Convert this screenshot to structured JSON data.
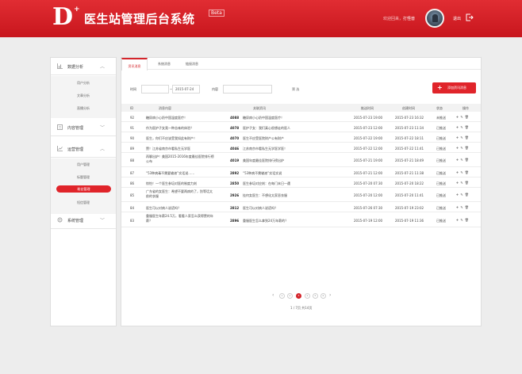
{
  "header": {
    "logo_letter": "D",
    "logo_plus": "+",
    "title": "医生站管理后台系统",
    "badge": "Beta",
    "welcome_prefix": "欢迎回来，",
    "username": "打怪兽",
    "logout": "退出"
  },
  "sidebar": {
    "groups": [
      {
        "label": "数据分析",
        "icon": "chart-icon",
        "items": [
          "用户分析",
          "文章分析",
          "直播分析"
        ]
      },
      {
        "label": "内容管理",
        "icon": "content-icon",
        "items": []
      },
      {
        "label": "运营管理",
        "icon": "operation-icon",
        "items": [
          "用户管理",
          "标题管理",
          "粉丝管理",
          "短信管理"
        ]
      },
      {
        "label": "系统管理",
        "icon": "gear-icon",
        "items": []
      }
    ],
    "active_item": "粉丝管理"
  },
  "tabs": [
    "资讯消息",
    "系统消息",
    "链接消息"
  ],
  "filter": {
    "time_label": "时间",
    "date_from": "",
    "separator": "—",
    "date_to": "2015-07-24",
    "content_label": "内容",
    "content_value": "",
    "search": "筛 选"
  },
  "add_button": {
    "plus": "+",
    "label": "添加资讯消息"
  },
  "table": {
    "columns": [
      "ID",
      "消息内容",
      "关联资讯",
      "推送时间",
      "创建时间",
      "状态",
      "操作"
    ],
    "rows": [
      {
        "id": "92",
        "content": "糖尿病小心奶中国温度医疗！",
        "count": "4088",
        "related": "糖尿病小心奶中国温度医疗！",
        "push": "2015-07-23 19:00",
        "created": "2015-07-23 16:32",
        "status": "未推送"
      },
      {
        "id": "91",
        "content": "作为医护子女竟一种苦味的体验？",
        "count": "4078",
        "related": "医护子女：我们真心很想走的医人",
        "push": "2015-07-23 12:00",
        "created": "2015-07-23 11:34",
        "status": "已推送"
      },
      {
        "id": "90",
        "content": "医生，你们不应该受我如此有财产！",
        "count": "4070",
        "related": "医生不应受医院财产公有财产",
        "push": "2015-07-22 19:00",
        "created": "2015-07-22 18:11",
        "status": "已推送"
      },
      {
        "id": "89",
        "content": "赞！江苏省南京市看私生无学医",
        "count": "4046",
        "related": "江苏南京市看私生无学医学医！",
        "push": "2015-07-22 12:00",
        "created": "2015-07-22 11:41",
        "status": "已推送"
      },
      {
        "id": "88",
        "content": "再聊出炉！美国2015-2016年度最佳医院排行榜公布",
        "count": "4019",
        "related": "美国年度最佳医院排行榜出炉",
        "push": "2015-07-21 19:00",
        "created": "2015-07-21 18:49",
        "status": "已推送"
      },
      {
        "id": "87",
        "content": "“53种病毒不需要输液”实话说……",
        "count": "2892",
        "related": "“53种病不需输液”实话实说",
        "push": "2015-07-21 12:00",
        "created": "2015-07-21 11:38",
        "status": "已推送"
      },
      {
        "id": "86",
        "content": "惊怕！一个医生参培对医的制度力刻",
        "count": "2850",
        "related": "医生参培对应刻：在每门末日一遭",
        "push": "2015-07-20 07:30",
        "created": "2015-07-20 18:22",
        "status": "已推送"
      },
      {
        "id": "85",
        "content": "广东省的女医生：希望不要两病的了，别等话太前的衣服",
        "count": "2926",
        "related": "挂何女医生：不想化太家恶衣服",
        "push": "2015-07-20 12:00",
        "created": "2015-07-20 11:41",
        "status": "已推送"
      },
      {
        "id": "84",
        "content": "医生可以对病人说谎吗？",
        "count": "2812",
        "related": "医生可以对病人说谎吗？",
        "push": "2015-07-26 07:30",
        "created": "2015-07-19 23:02",
        "status": "已推送"
      },
      {
        "id": "83",
        "content": "重服医生年薪24.5万，看看人家怎么获得赞的年薪？",
        "count": "2896",
        "related": "重服医生怎么拿到24万年薪的？",
        "push": "2015-07-19 12:00",
        "created": "2015-07-19 11:36",
        "status": "已推送"
      }
    ]
  },
  "pagination": {
    "prev": "‹",
    "next": "›",
    "pages": [
      "1",
      "2",
      "3",
      "4",
      "5",
      "6"
    ],
    "current": "3",
    "info": "1 / 7页 共14页"
  },
  "colors": {
    "brand": "#d4252b",
    "background": "#ededed"
  }
}
